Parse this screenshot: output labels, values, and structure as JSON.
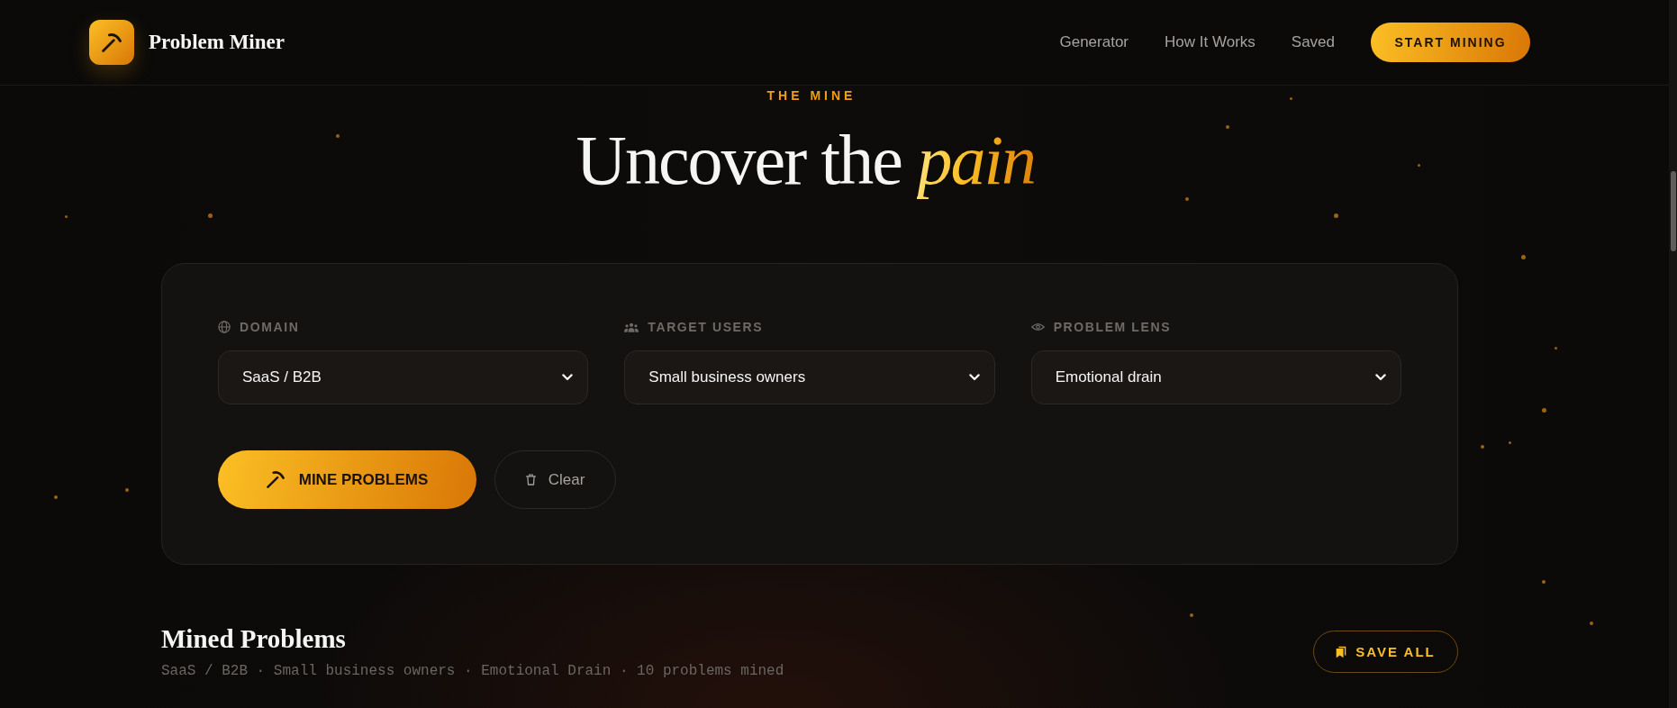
{
  "header": {
    "brand": "Problem Miner",
    "nav": [
      {
        "label": "Generator"
      },
      {
        "label": "How It Works"
      },
      {
        "label": "Saved"
      }
    ],
    "cta": "START MINING"
  },
  "hero": {
    "eyebrow": "THE MINE",
    "title": "Uncover the *pain*"
  },
  "form": {
    "fields": [
      {
        "kind": "domain",
        "label": "DOMAIN",
        "value": "SaaS / B2B"
      },
      {
        "kind": "users",
        "label": "TARGET USERS",
        "value": "Small business owners"
      },
      {
        "kind": "lens",
        "label": "PROBLEM LENS",
        "value": "Emotional drain"
      }
    ],
    "actions": [
      {
        "kind": "mine",
        "label": "MINE PROBLEMS"
      },
      {
        "kind": "clear",
        "label": "Clear"
      }
    ]
  },
  "results": {
    "title": "Mined Problems",
    "summary": "SaaS / B2B · Small business owners · Emotional Drain · 10 problems mined",
    "save_all": "SAVE ALL"
  }
}
